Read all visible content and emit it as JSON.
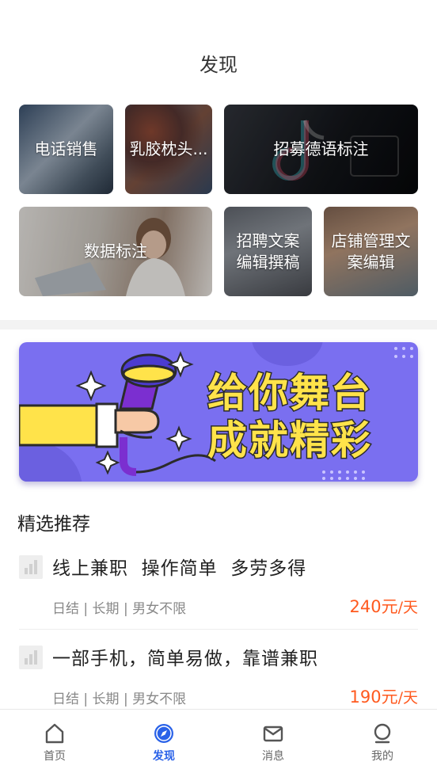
{
  "header": {
    "title": "发现"
  },
  "categories": [
    {
      "label": "电话销售"
    },
    {
      "label": "乳胶枕头..."
    },
    {
      "label": "招募德语标注"
    },
    {
      "label": "数据标注"
    },
    {
      "label": "招聘文案\n编辑撰稿"
    },
    {
      "label": "店铺管理文\n案编辑"
    }
  ],
  "banner": {
    "line1": "给你舞台",
    "line2": "成就精彩"
  },
  "section": {
    "title": "精选推荐"
  },
  "jobs": [
    {
      "title": "线上兼职  操作简单  多劳多得",
      "tags": "日结 | 长期 | 男女不限",
      "price": "240元",
      "unit": "/天"
    },
    {
      "title": "一部手机，简单易做，靠谱兼职",
      "tags": "日结 | 长期 | 男女不限",
      "price": "190元",
      "unit": "/天"
    }
  ],
  "tabbar": {
    "items": [
      {
        "label": "首页",
        "icon": "home-icon"
      },
      {
        "label": "发现",
        "icon": "compass-icon",
        "active": true
      },
      {
        "label": "消息",
        "icon": "mail-icon"
      },
      {
        "label": "我的",
        "icon": "user-icon"
      }
    ]
  },
  "colors": {
    "accent": "#2a62e8",
    "price": "#ff5a1f",
    "banner_bg": "#7a6ff0",
    "banner_text": "#ffe34a"
  }
}
